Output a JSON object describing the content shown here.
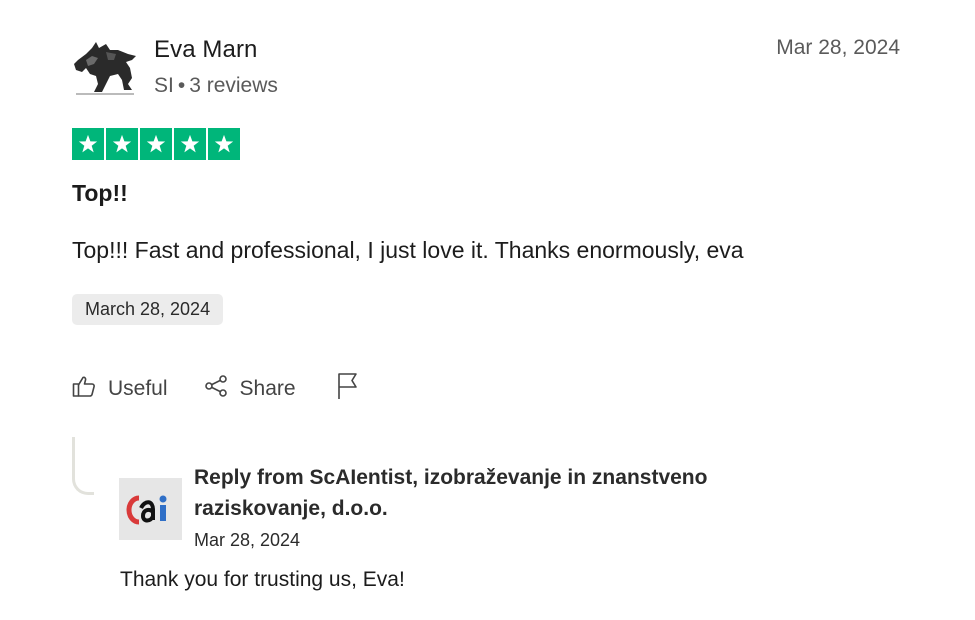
{
  "reviewer": {
    "name": "Eva Marn",
    "country": "SI",
    "separator": "•",
    "reviews_count": "3 reviews"
  },
  "review": {
    "date_top": "Mar 28, 2024",
    "rating": 5,
    "rating_max": 5,
    "title": "Top!!",
    "body": "Top!!! Fast and professional, I just love it. Thanks enormously, eva",
    "experience_date": "March 28, 2024"
  },
  "actions": {
    "useful_label": "Useful",
    "share_label": "Share",
    "report_icon": "flag-icon"
  },
  "reply": {
    "from": "Reply from ScAIentist, izobraževanje in znanstveno raziskovanje, d.o.o.",
    "date": "Mar 28, 2024",
    "text": "Thank you for trusting us, Eva!"
  },
  "colors": {
    "star_green": "#00b67a",
    "logo_red": "#d93a3a",
    "logo_blue": "#2f6fc7"
  }
}
